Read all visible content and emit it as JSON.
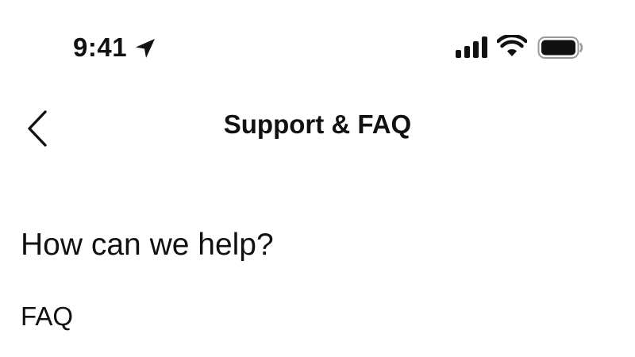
{
  "status_bar": {
    "time": "9:41",
    "icons": {
      "location": "location-arrow-icon",
      "signal": "cellular-signal-icon",
      "wifi": "wifi-icon",
      "battery": "battery-icon"
    }
  },
  "nav": {
    "back_icon": "chevron-left-icon",
    "title": "Support & FAQ"
  },
  "content": {
    "heading": "How can we help?",
    "section_label": "FAQ"
  },
  "colors": {
    "text": "#111111",
    "background": "#ffffff"
  }
}
